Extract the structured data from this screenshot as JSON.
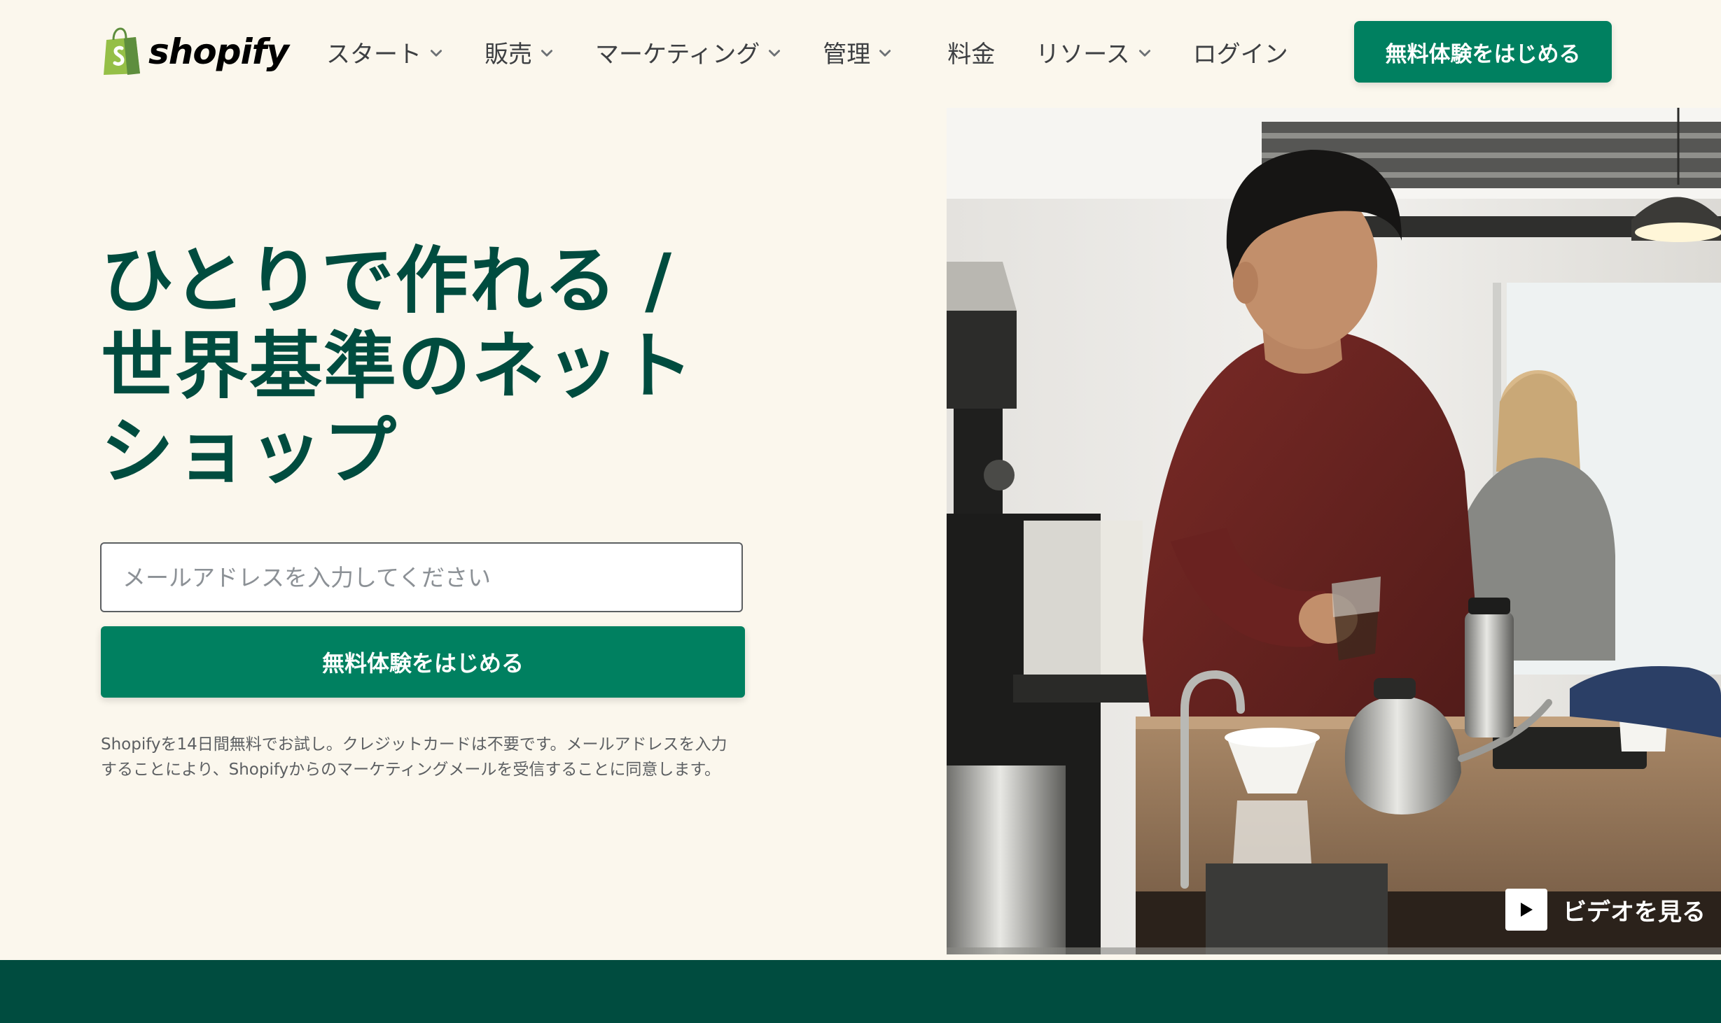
{
  "brand": {
    "name": "shopify",
    "accent_color": "#008060",
    "dark_green": "#004c3f",
    "background": "#fbf7ed"
  },
  "nav": {
    "items": [
      {
        "label": "スタート",
        "has_dropdown": true
      },
      {
        "label": "販売",
        "has_dropdown": true
      },
      {
        "label": "マーケティング",
        "has_dropdown": true
      },
      {
        "label": "管理",
        "has_dropdown": true
      },
      {
        "label": "料金",
        "has_dropdown": false
      },
      {
        "label": "リソース",
        "has_dropdown": true
      },
      {
        "label": "ログイン",
        "has_dropdown": false
      }
    ],
    "cta_label": "無料体験をはじめる"
  },
  "hero": {
    "title": "ひとりで作れる / 世界基準のネットショップ",
    "email_placeholder": "メールアドレスを入力してください",
    "email_value": "",
    "cta_label": "無料体験をはじめる",
    "disclaimer": "Shopifyを14日間無料でお試し。クレジットカードは不要です。メールアドレスを入力することにより、Shopifyからのマーケティングメールを受信することに同意します。",
    "video_label": "ビデオを見る",
    "video_icon": "play-icon",
    "image_alt": "barista-pouring-coffee"
  }
}
